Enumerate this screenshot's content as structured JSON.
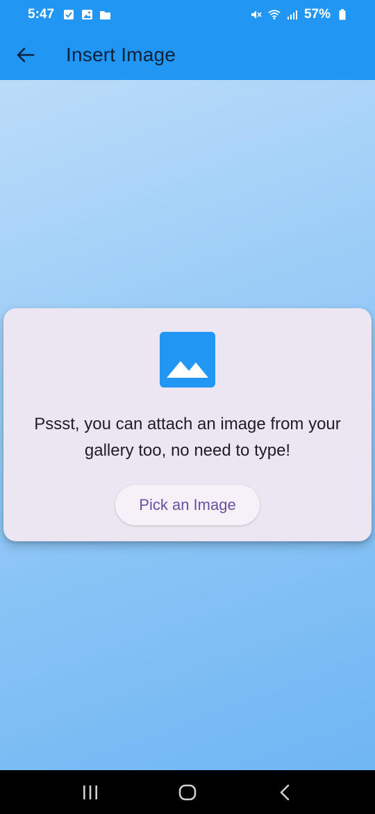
{
  "status_bar": {
    "time": "5:47",
    "battery": "57%",
    "left_icons": [
      "checkbox-icon",
      "gallery-icon",
      "folder-icon"
    ],
    "right_icons": [
      "mute-icon",
      "wifi-icon",
      "signal-icon",
      "battery-icon"
    ]
  },
  "app_bar": {
    "title": "Insert Image",
    "back_icon": "arrow-back-icon",
    "color": "#2196F3"
  },
  "card": {
    "icon": "image-icon",
    "icon_color": "#2196F3",
    "message": "Pssst, you can attach an image from your gallery too, no need to type!",
    "button_label": "Pick an Image",
    "button_text_color": "#6a4fa0"
  },
  "nav_bar": {
    "buttons": [
      "recents-icon",
      "home-icon",
      "back-icon"
    ]
  }
}
